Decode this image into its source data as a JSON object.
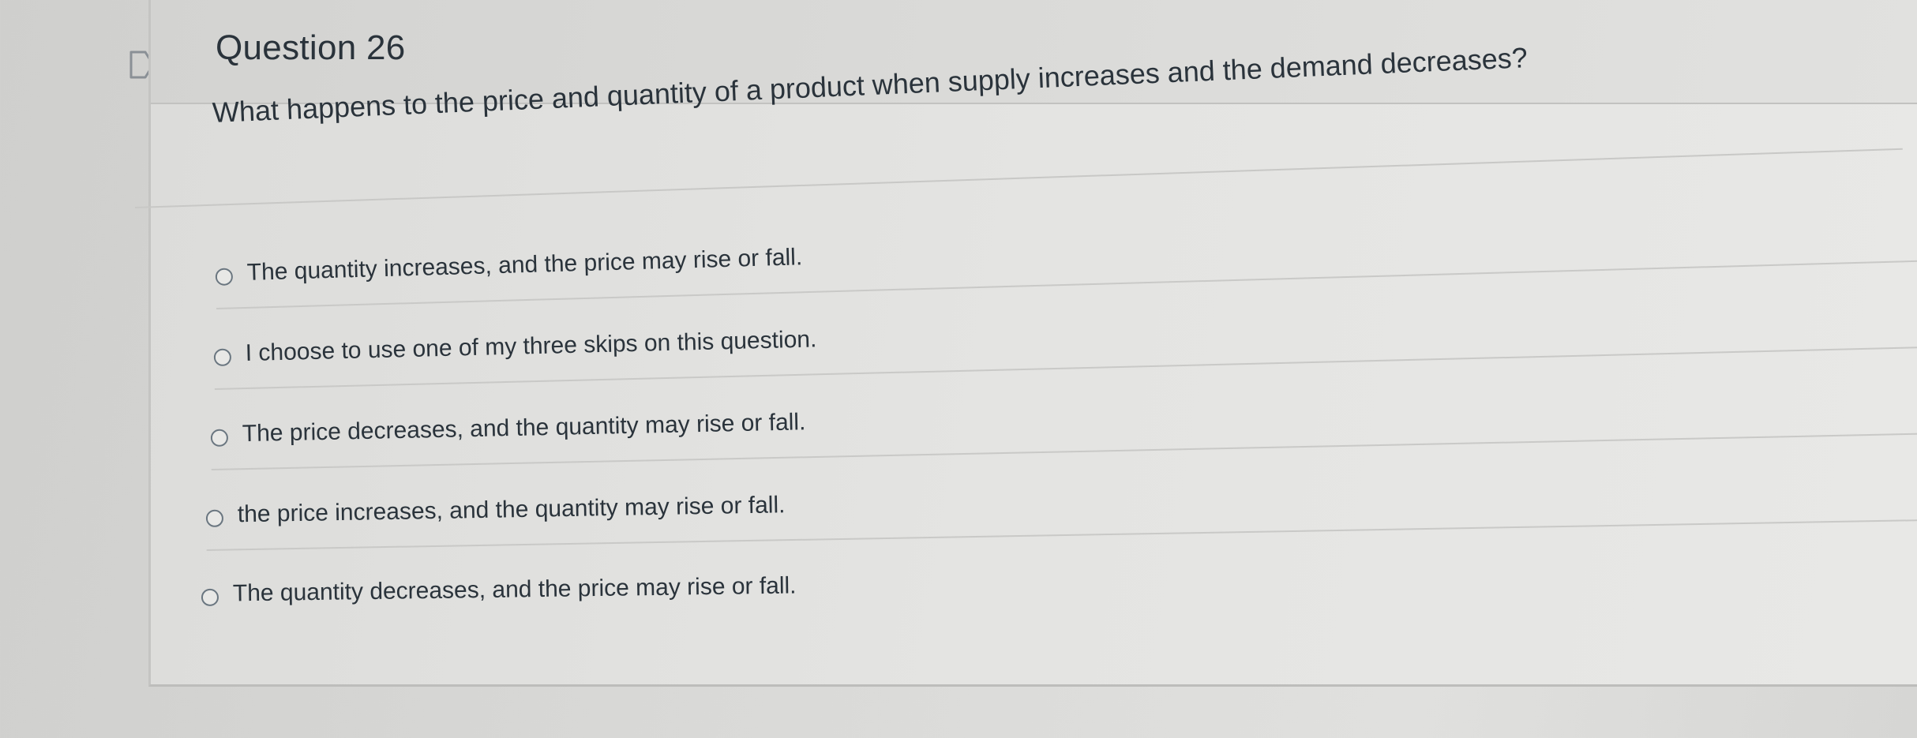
{
  "question": {
    "title": "Question 26",
    "text": "What happens to the price and quantity of a product when supply increases and the demand decreases?"
  },
  "answers": [
    {
      "label": "The quantity increases, and the price may rise or fall."
    },
    {
      "label": "I choose to use one of my three skips on this question."
    },
    {
      "label": "The price decreases, and the quantity may rise or fall."
    },
    {
      "label": "the price increases, and the quantity may rise or fall."
    },
    {
      "label": "The quantity decreases, and the price may rise or fall."
    }
  ],
  "icons": {
    "flag": "flag-icon",
    "radio": "radio-circle"
  },
  "colors": {
    "text": "#2a333b",
    "radio_border": "#6a7680",
    "divider": "#c8c8c6"
  }
}
